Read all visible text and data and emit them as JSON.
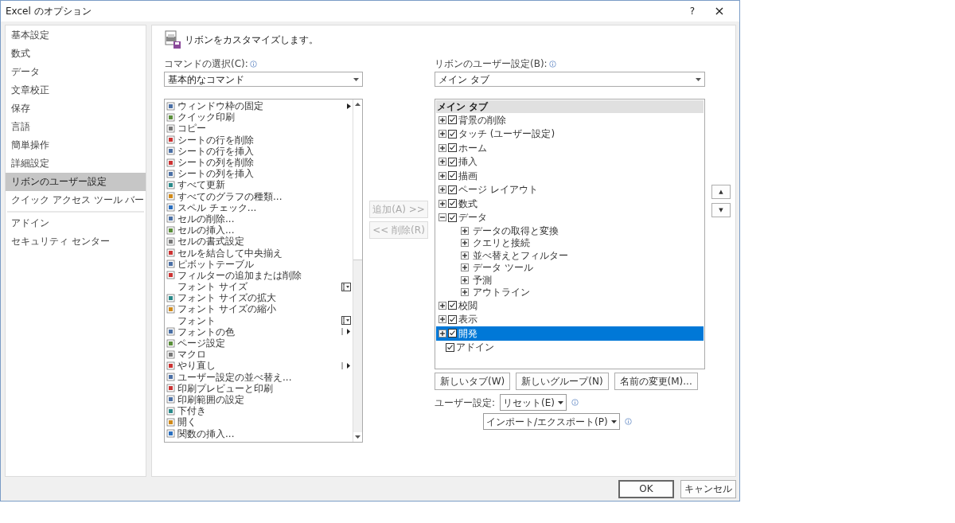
{
  "window": {
    "title": "Excel のオプション",
    "help": "?",
    "close": "×"
  },
  "sidebar": {
    "groups": [
      [
        {
          "label": "基本設定",
          "selected": false
        },
        {
          "label": "数式",
          "selected": false
        },
        {
          "label": "データ",
          "selected": false
        },
        {
          "label": "文章校正",
          "selected": false
        },
        {
          "label": "保存",
          "selected": false
        },
        {
          "label": "言語",
          "selected": false
        },
        {
          "label": "簡単操作",
          "selected": false
        },
        {
          "label": "詳細設定",
          "selected": false
        },
        {
          "label": "リボンのユーザー設定",
          "selected": true
        },
        {
          "label": "クイック アクセス ツール バー",
          "selected": false
        }
      ],
      [
        {
          "label": "アドイン",
          "selected": false
        },
        {
          "label": "セキュリティ センター",
          "selected": false
        }
      ]
    ]
  },
  "heading": "リボンをカスタマイズします。",
  "commands": {
    "label": "コマンドの選択(C):",
    "select": "基本的なコマンド",
    "items": [
      {
        "label": "ウィンドウ枠の固定",
        "icon": true,
        "kind": "submenu"
      },
      {
        "label": "クイック印刷",
        "icon": true,
        "kind": "plain"
      },
      {
        "label": "コピー",
        "icon": true,
        "kind": "plain"
      },
      {
        "label": "シートの行を削除",
        "icon": true,
        "kind": "plain"
      },
      {
        "label": "シートの行を挿入",
        "icon": true,
        "kind": "plain"
      },
      {
        "label": "シートの列を削除",
        "icon": true,
        "kind": "plain"
      },
      {
        "label": "シートの列を挿入",
        "icon": true,
        "kind": "plain"
      },
      {
        "label": "すべて更新",
        "icon": true,
        "kind": "plain"
      },
      {
        "label": "すべてのグラフの種類...",
        "icon": true,
        "kind": "plain"
      },
      {
        "label": "スペル チェック...",
        "icon": true,
        "kind": "plain"
      },
      {
        "label": "セルの削除...",
        "icon": true,
        "kind": "plain"
      },
      {
        "label": "セルの挿入...",
        "icon": true,
        "kind": "plain"
      },
      {
        "label": "セルの書式設定",
        "icon": true,
        "kind": "plain"
      },
      {
        "label": "セルを結合して中央揃え",
        "icon": true,
        "kind": "plain"
      },
      {
        "label": "ピボットテーブル",
        "icon": true,
        "kind": "plain"
      },
      {
        "label": "フィルターの追加または削除",
        "icon": true,
        "kind": "plain"
      },
      {
        "label": "フォント サイズ",
        "icon": false,
        "kind": "dropdown"
      },
      {
        "label": "フォント サイズの拡大",
        "icon": true,
        "kind": "plain"
      },
      {
        "label": "フォント サイズの縮小",
        "icon": true,
        "kind": "plain"
      },
      {
        "label": "フォント",
        "icon": false,
        "kind": "dropdown"
      },
      {
        "label": "フォントの色",
        "icon": true,
        "kind": "split"
      },
      {
        "label": "ページ設定",
        "icon": true,
        "kind": "plain"
      },
      {
        "label": "マクロ",
        "icon": true,
        "kind": "plain"
      },
      {
        "label": "やり直し",
        "icon": true,
        "kind": "split"
      },
      {
        "label": "ユーザー設定の並べ替え...",
        "icon": true,
        "kind": "plain"
      },
      {
        "label": "印刷プレビューと印刷",
        "icon": true,
        "kind": "plain"
      },
      {
        "label": "印刷範囲の設定",
        "icon": true,
        "kind": "plain"
      },
      {
        "label": "下付き",
        "icon": true,
        "kind": "plain"
      },
      {
        "label": "開く",
        "icon": true,
        "kind": "plain"
      },
      {
        "label": "関数の挿入...",
        "icon": true,
        "kind": "plain"
      }
    ]
  },
  "transfer": [
    {
      "label": "追加(A) >>",
      "disabled": true
    },
    {
      "label": "<< 削除(R)",
      "disabled": true
    }
  ],
  "ribbon": {
    "label": "リボンのユーザー設定(B):",
    "select": "メイン タブ",
    "header": "メイン タブ",
    "tabs": [
      {
        "label": "背景の削除",
        "checked": true,
        "expandable": true,
        "selected": false
      },
      {
        "label": "タッチ (ユーザー設定)",
        "checked": true,
        "expandable": true,
        "selected": false
      },
      {
        "label": "ホーム",
        "checked": true,
        "expandable": true,
        "selected": false
      },
      {
        "label": "挿入",
        "checked": true,
        "expandable": true,
        "selected": false
      },
      {
        "label": "描画",
        "checked": true,
        "expandable": true,
        "selected": false
      },
      {
        "label": "ページ レイアウト",
        "checked": true,
        "expandable": true,
        "selected": false
      },
      {
        "label": "数式",
        "checked": true,
        "expandable": true,
        "selected": false
      },
      {
        "label": "データ",
        "checked": true,
        "expandable": true,
        "selected": false,
        "children": [
          {
            "label": "データの取得と変換",
            "expanded": false
          },
          {
            "label": "クエリと接続",
            "expanded": false
          },
          {
            "label": "並べ替えとフィルター",
            "expanded": false
          },
          {
            "label": "データ ツール",
            "expanded": false
          },
          {
            "label": "予測",
            "expanded": false
          },
          {
            "label": "アウトライン",
            "expanded": false
          }
        ]
      },
      {
        "label": "校閲",
        "checked": true,
        "expandable": true,
        "selected": false
      },
      {
        "label": "表示",
        "checked": true,
        "expandable": true,
        "selected": false
      },
      {
        "label": "開発",
        "checked": true,
        "expandable": true,
        "selected": true
      },
      {
        "label": "アドイン",
        "checked": true,
        "expandable": false,
        "selected": false
      }
    ],
    "buttons": [
      "新しいタブ(W)",
      "新しいグループ(N)",
      "名前の変更(M)..."
    ],
    "settings_label": "ユーザー設定:",
    "reset": "リセット(E)",
    "import_export": "インポート/エクスポート(P)"
  },
  "move": {
    "up": "▲",
    "down": "▼"
  },
  "footer": {
    "ok": "OK",
    "cancel": "キャンセル"
  }
}
